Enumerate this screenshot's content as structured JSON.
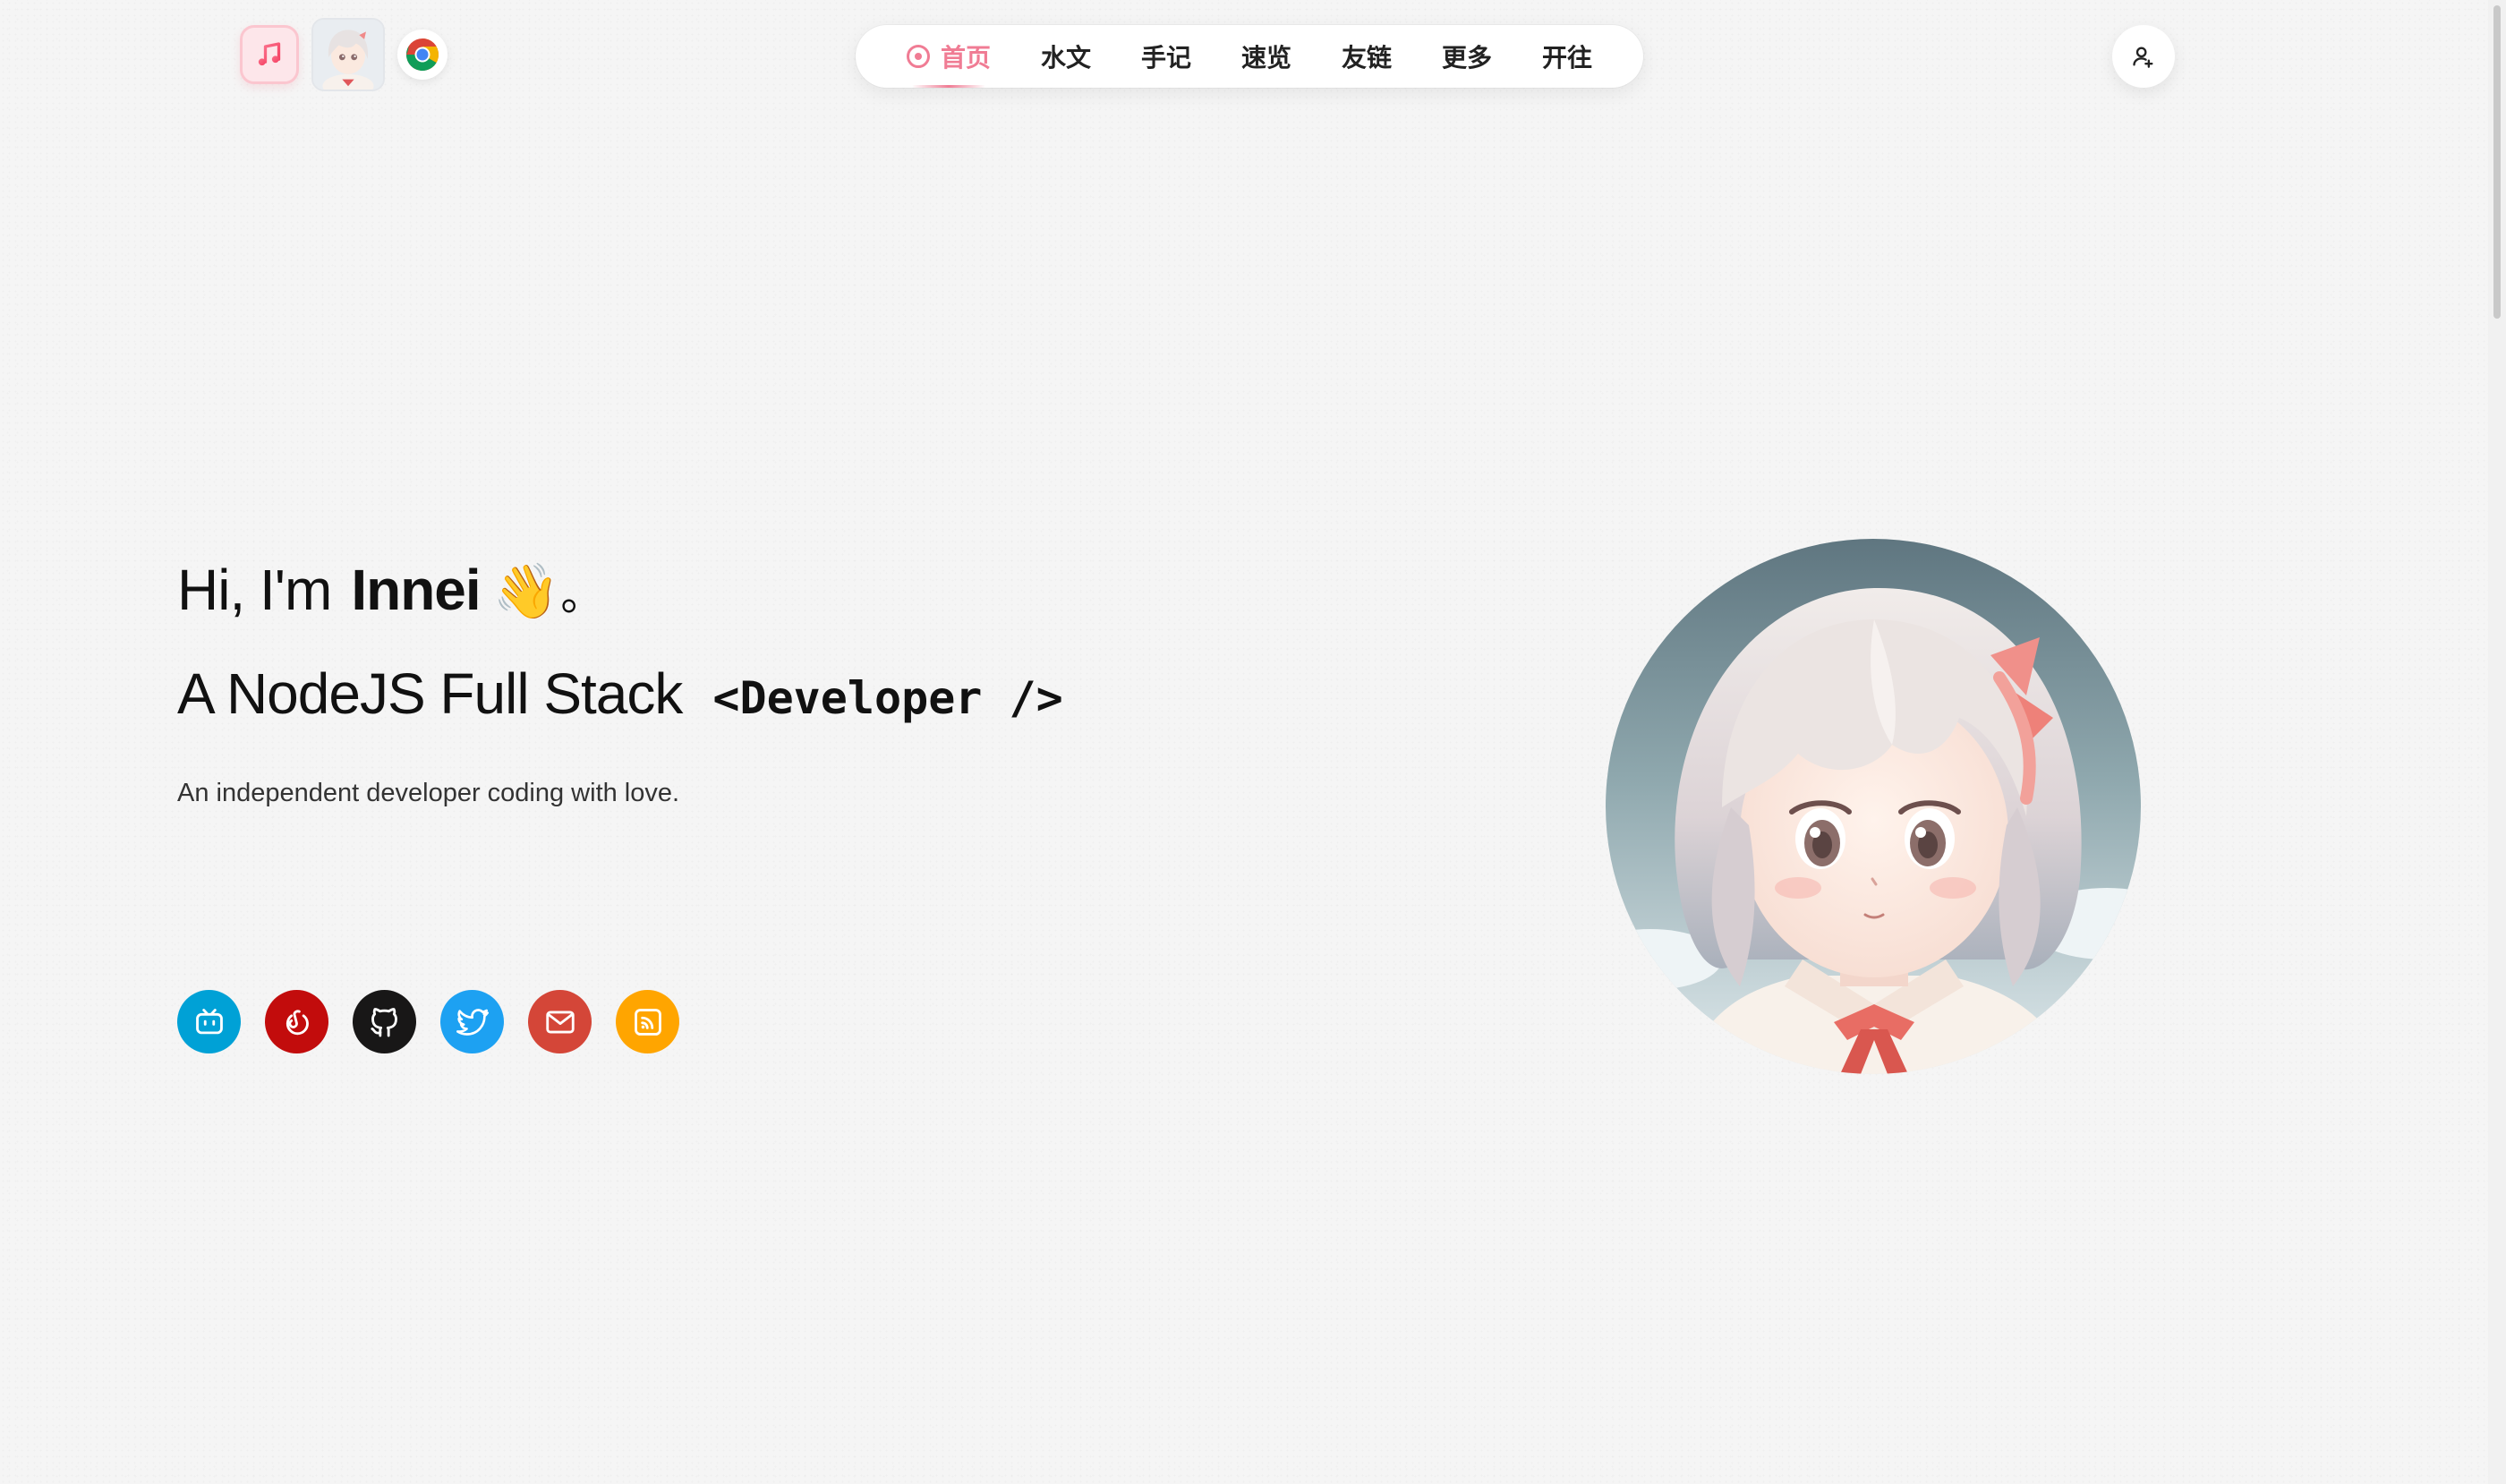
{
  "header": {
    "apps": [
      {
        "name": "music-app-icon"
      },
      {
        "name": "avatar-app-icon"
      },
      {
        "name": "chrome-icon"
      }
    ]
  },
  "nav": {
    "items": [
      {
        "label": "首页",
        "active": true
      },
      {
        "label": "水文"
      },
      {
        "label": "手记"
      },
      {
        "label": "速览"
      },
      {
        "label": "友链"
      },
      {
        "label": "更多"
      },
      {
        "label": "开往"
      }
    ]
  },
  "hero": {
    "greeting": "Hi, I'm",
    "name": "Innei",
    "wave": "👋",
    "punct": "。",
    "role": "A NodeJS Full Stack",
    "code": "<Developer />",
    "subtitle": "An independent developer coding with love."
  },
  "socials": [
    {
      "name": "bilibili-icon",
      "color": "#00a1d6"
    },
    {
      "name": "netease-music-icon",
      "color": "#c20c0c"
    },
    {
      "name": "github-icon",
      "color": "#181717"
    },
    {
      "name": "twitter-icon",
      "color": "#1da1f2"
    },
    {
      "name": "mail-icon",
      "color": "#d44638"
    },
    {
      "name": "rss-icon",
      "color": "#ffa500"
    }
  ],
  "colors": {
    "accent": "#f07c94",
    "background": "#f5f5f5"
  }
}
